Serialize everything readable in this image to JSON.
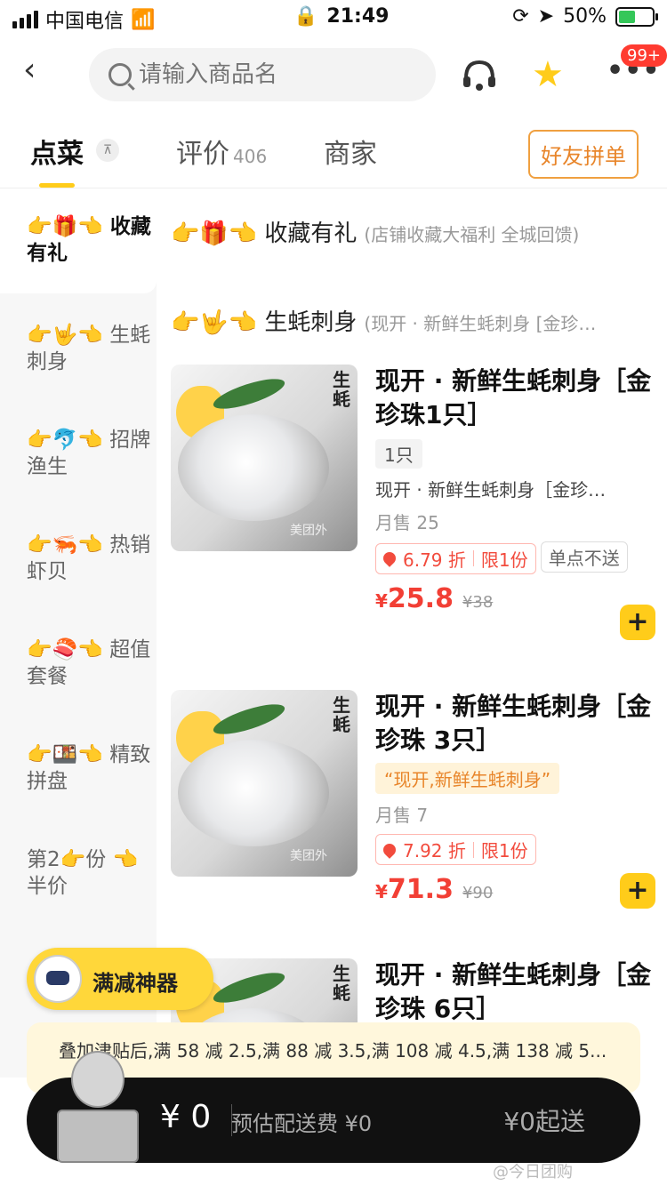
{
  "status_bar": {
    "carrier": "中国电信",
    "time": "21:49",
    "battery": "50%"
  },
  "header": {
    "search_placeholder": "请输入商品名",
    "message_badge": "99+"
  },
  "tabs": {
    "order": "点菜",
    "reviews": "评价",
    "reviews_count": "406",
    "merchant": "商家",
    "group_button": "好友拼单"
  },
  "sidebar": {
    "items": [
      {
        "label": "👉🎁👈 收藏有礼"
      },
      {
        "label": "👉🤟👈 生蚝刺身"
      },
      {
        "label": "👉🐬👈 招牌渔生"
      },
      {
        "label": "👉🦐👈 热销虾贝"
      },
      {
        "label": "👉🍣👈 超值套餐"
      },
      {
        "label": "👉🍱👈 精致拼盘"
      },
      {
        "label": "第2👉份 👈半价"
      }
    ]
  },
  "sections": [
    {
      "title": "👉🎁👈 收藏有礼",
      "sub": "(店铺收藏大福利 全城回馈)"
    },
    {
      "title": "👉🤟👈 生蚝刺身",
      "sub": "(现开 · 新鲜生蚝刺身 [金珍…"
    }
  ],
  "products": [
    {
      "name": "现开 · 新鲜生蚝刺身［金珍珠1只］",
      "spec": "1只",
      "desc": "现开 · 新鲜生蚝刺身［金珍…",
      "sales": "月售 25",
      "discount": "6.79 折",
      "limit": "限1份",
      "no_single": "单点不送",
      "price": "25.8",
      "original_price": "¥38"
    },
    {
      "name": "现开 · 新鲜生蚝刺身［金珍珠 3只］",
      "quote": "“现开,新鲜生蚝刺身”",
      "sales": "月售 7",
      "discount": "7.92 折",
      "limit": "限1份",
      "price": "71.3",
      "original_price": "¥90"
    },
    {
      "name": "现开 · 新鲜生蚝刺身［金珍珠 6只］"
    }
  ],
  "image_watermark": "美团外",
  "image_calligraphy": "生蚝",
  "floating_promo": "满减神器",
  "promo_tip": "叠加津贴后,满 58 减 2.5,满 88 减 3.5,满 108 减 4.5,满 138 减 5...",
  "cart": {
    "total": "¥ 0",
    "delivery_fee": "预估配送费 ¥0",
    "min_order": "¥0起送"
  },
  "watermark": "@今日团购"
}
